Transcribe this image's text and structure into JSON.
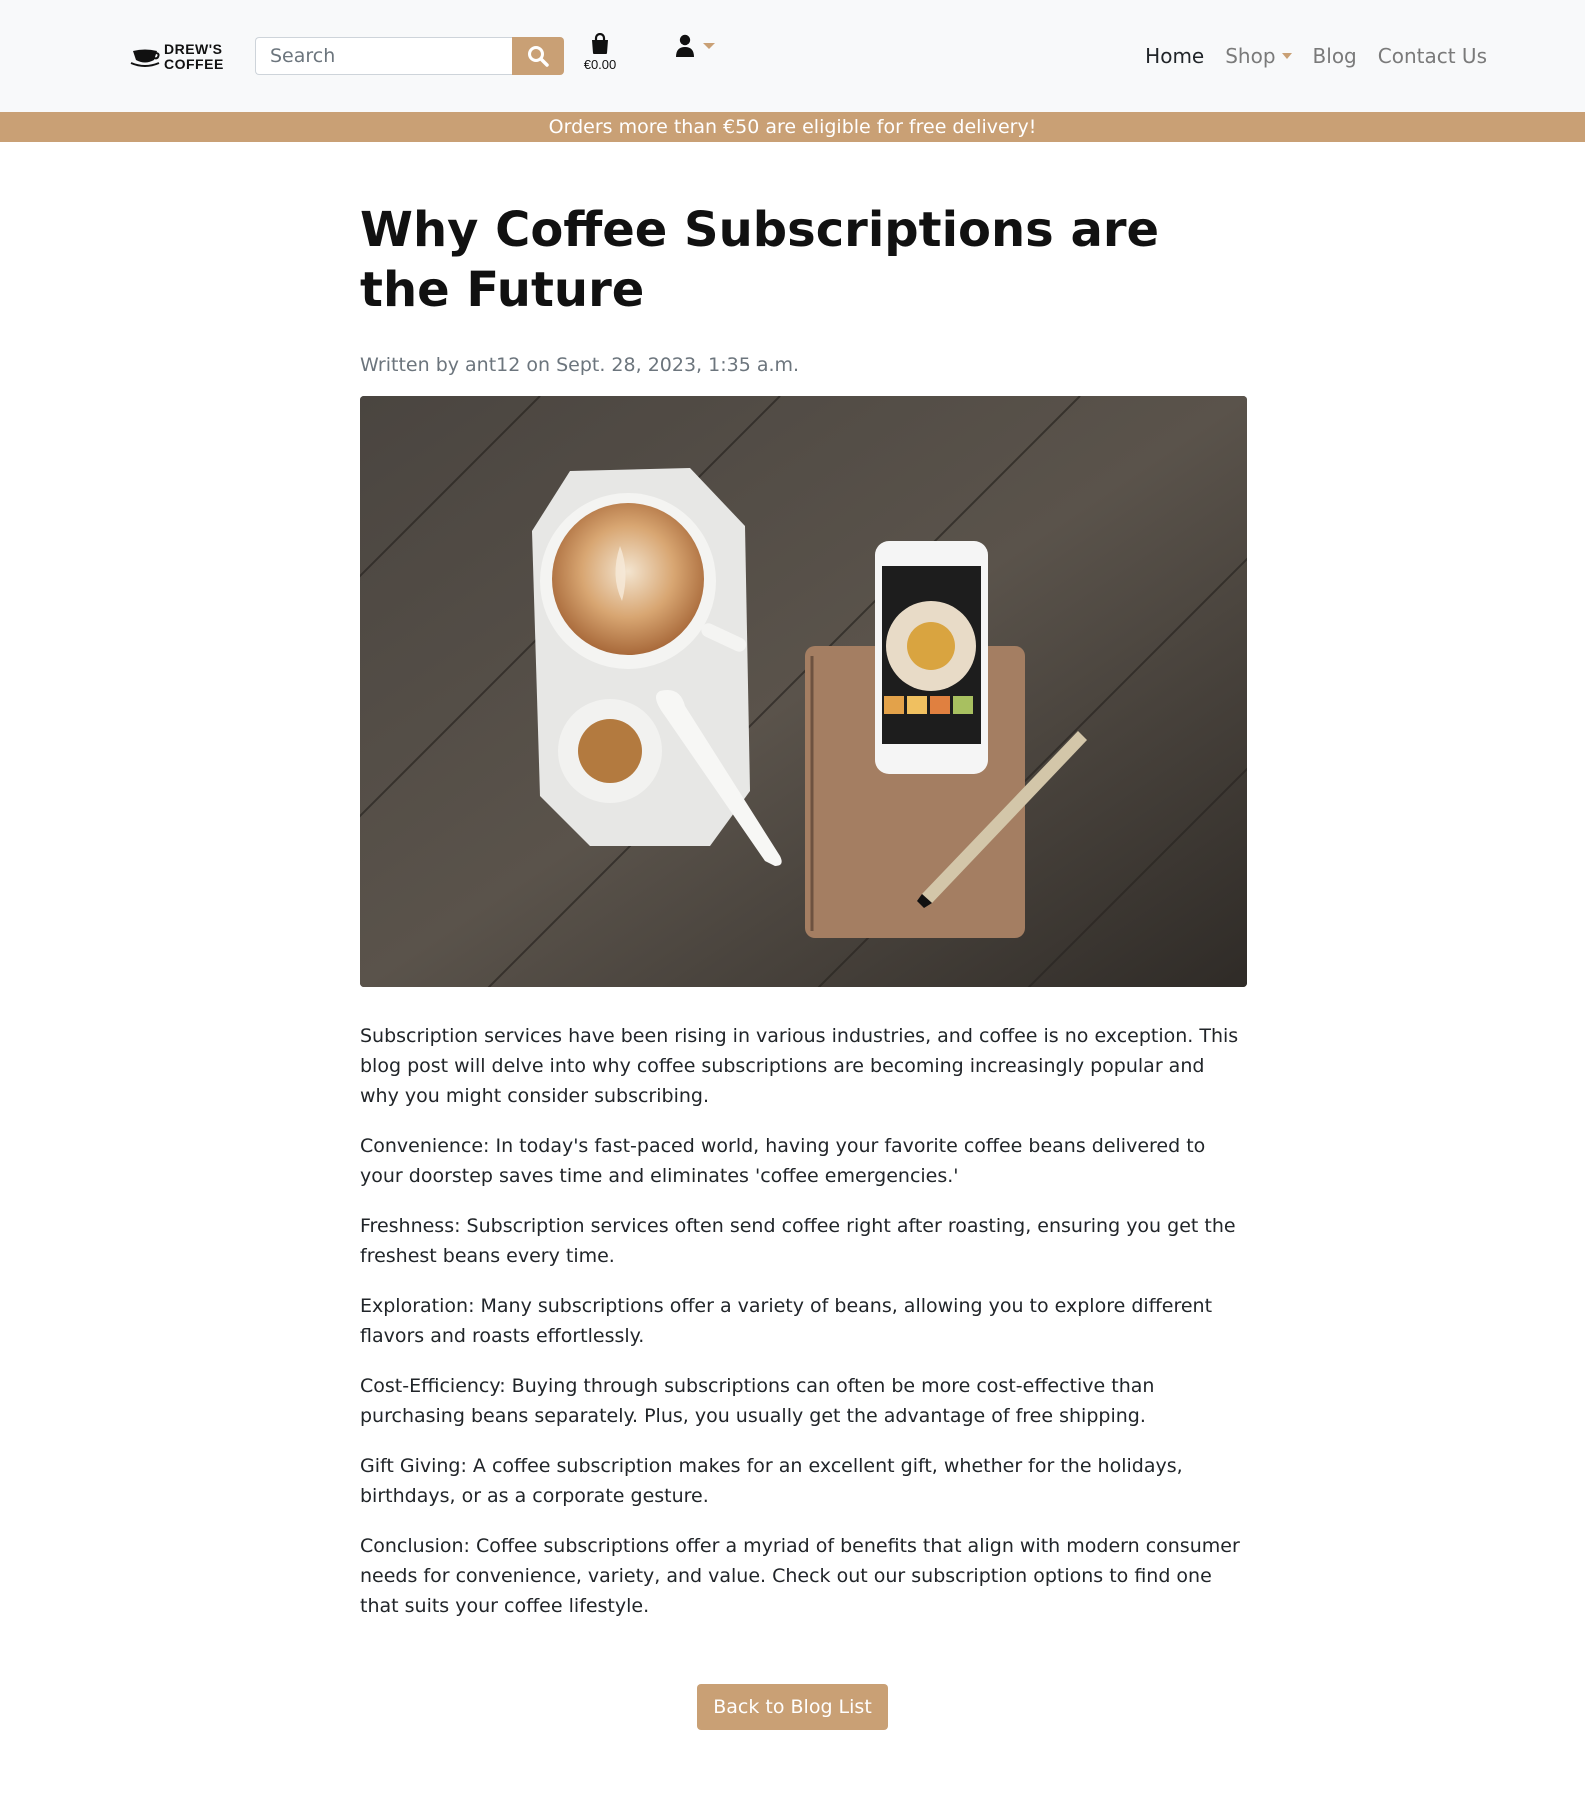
{
  "brand": {
    "logo_text_line1": "DREW'S",
    "logo_text_line2": "COFFEE"
  },
  "search": {
    "placeholder": "Search"
  },
  "cart": {
    "total": "€0.00"
  },
  "nav": {
    "home": "Home",
    "shop": "Shop",
    "blog": "Blog",
    "contact": "Contact Us"
  },
  "banner": {
    "text": "Orders more than €50 are eligible for free delivery!"
  },
  "post": {
    "title": "Why Coffee Subscriptions are the Future",
    "meta": "Written by ant12 on Sept. 28, 2023, 1:35 a.m.",
    "paragraphs": [
      "Subscription services have been rising in various industries, and coffee is no exception. This blog post will delve into why coffee subscriptions are becoming increasingly popular and why you might consider subscribing.",
      "Convenience: In today's fast-paced world, having your favorite coffee beans delivered to your doorstep saves time and eliminates 'coffee emergencies.'",
      "Freshness: Subscription services often send coffee right after roasting, ensuring you get the freshest beans every time.",
      "Exploration: Many subscriptions offer a variety of beans, allowing you to explore different flavors and roasts effortlessly.",
      "Cost-Efficiency: Buying through subscriptions can often be more cost-effective than purchasing beans separately. Plus, you usually get the advantage of free shipping.",
      "Gift Giving: A coffee subscription makes for an excellent gift, whether for the holidays, birthdays, or as a corporate gesture.",
      "Conclusion: Coffee subscriptions offer a myriad of benefits that align with modern consumer needs for convenience, variety, and value. Check out our subscription options to find one that suits your coffee lifestyle."
    ]
  },
  "back_button": {
    "label": "Back to Blog List"
  },
  "colors": {
    "accent": "#c9a075",
    "navbar_bg": "#f8f9fa",
    "muted_text": "#6c757d"
  }
}
